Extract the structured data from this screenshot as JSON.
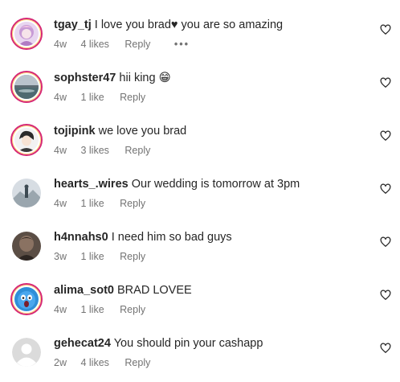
{
  "comments": [
    {
      "username": "tgay_tj",
      "text": "I love you brad♥ you are so amazing",
      "time": "4w",
      "likes": "4 likes",
      "reply": "Reply",
      "more": "•••",
      "avatar": "anime-girl-avatar"
    },
    {
      "username": "sophster47",
      "text": "hii king 😁",
      "time": "4w",
      "likes": "1 like",
      "reply": "Reply",
      "avatar": "sunset-landscape-avatar"
    },
    {
      "username": "tojipink",
      "text": "we love you brad",
      "time": "4w",
      "likes": "3 likes",
      "reply": "Reply",
      "avatar": "anime-character-avatar"
    },
    {
      "username": "hearts_.wires",
      "text": "Our wedding is tomorrow at 3pm",
      "time": "4w",
      "likes": "1 like",
      "reply": "Reply",
      "avatar": "mountain-figure-avatar"
    },
    {
      "username": "h4nnahs0",
      "text": "I need him so bad guys",
      "time": "3w",
      "likes": "1 like",
      "reply": "Reply",
      "avatar": "dark-photo-avatar"
    },
    {
      "username": "alima_sot0",
      "text": "BRAD LOVEE",
      "time": "4w",
      "likes": "1 like",
      "reply": "Reply",
      "avatar": "screaming-emoji-avatar"
    },
    {
      "username": "gehecat24",
      "text": "You should pin your cashapp",
      "time": "2w",
      "likes": "4 likes",
      "reply": "Reply",
      "avatar": "default-user-avatar"
    }
  ],
  "colors": {
    "text": "#262626",
    "meta": "#737373",
    "story_ring": "#d62976"
  },
  "icons": {
    "like": "heart-outline-icon",
    "more": "more-options-icon"
  }
}
